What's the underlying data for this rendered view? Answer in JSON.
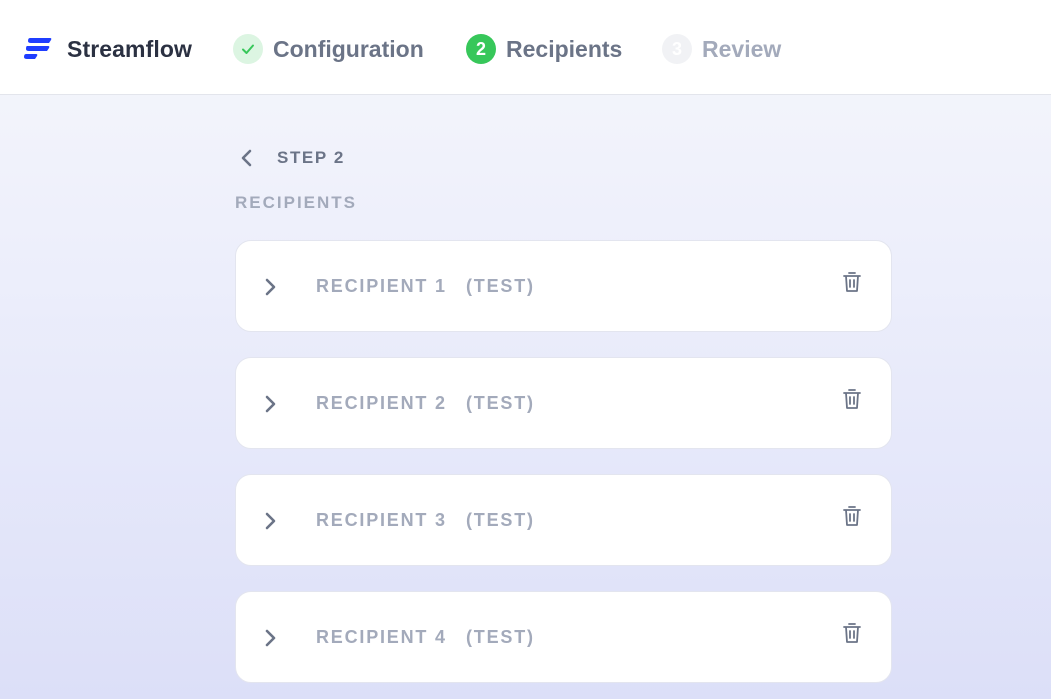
{
  "header": {
    "brand": "Streamflow",
    "steps": [
      {
        "number": "",
        "label": "Configuration",
        "state": "completed"
      },
      {
        "number": "2",
        "label": "Recipients",
        "state": "active"
      },
      {
        "number": "3",
        "label": "Review",
        "state": "upcoming"
      }
    ]
  },
  "main": {
    "back_step_label": "STEP 2",
    "section_title": "RECIPIENTS",
    "recipients": [
      {
        "title": "RECIPIENT 1",
        "tag": "(TEST)"
      },
      {
        "title": "RECIPIENT 2",
        "tag": "(TEST)"
      },
      {
        "title": "RECIPIENT 3",
        "tag": "(TEST)"
      },
      {
        "title": "RECIPIENT 4",
        "tag": "(TEST)"
      }
    ]
  },
  "colors": {
    "brand_blue": "#1f3dff",
    "success_green": "#37c75a",
    "text_dark": "#2b3142",
    "text_muted": "#a3aabb"
  },
  "icons": {
    "logo": "streamflow-logo-icon",
    "completed": "check-icon",
    "back": "chevron-left-icon",
    "expand": "chevron-right-icon",
    "delete": "trash-icon"
  }
}
